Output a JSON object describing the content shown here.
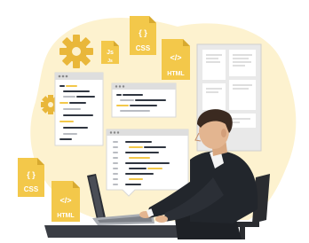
{
  "file_icons": {
    "css_top": {
      "glyph": "{ }",
      "label": "CSS"
    },
    "js_top": {
      "glyph": "Js",
      "label": "Js"
    },
    "html_top": {
      "glyph": "</>",
      "label": "HTML"
    },
    "css_bottom": {
      "glyph": "{ }",
      "label": "CSS"
    },
    "html_bottom": {
      "glyph": "</>",
      "label": "HTML"
    }
  },
  "colors": {
    "blob": "#fdf2cf",
    "accent": "#f5c542",
    "file_icon": "#f3c84a",
    "gear": "#e9b73a",
    "window_bar": "#dedede",
    "code_dark": "#2f3540",
    "code_yellow": "#f3c84a",
    "code_gray": "#b9bcc2",
    "suit": "#22262c",
    "skin": "#e3b590",
    "hair": "#3b2a20",
    "laptop": "#a9adb3"
  },
  "icons": [
    "gear-icon",
    "css-file-icon",
    "js-file-icon",
    "html-file-icon",
    "code-window",
    "wireframe-board",
    "laptop",
    "office-chair"
  ]
}
